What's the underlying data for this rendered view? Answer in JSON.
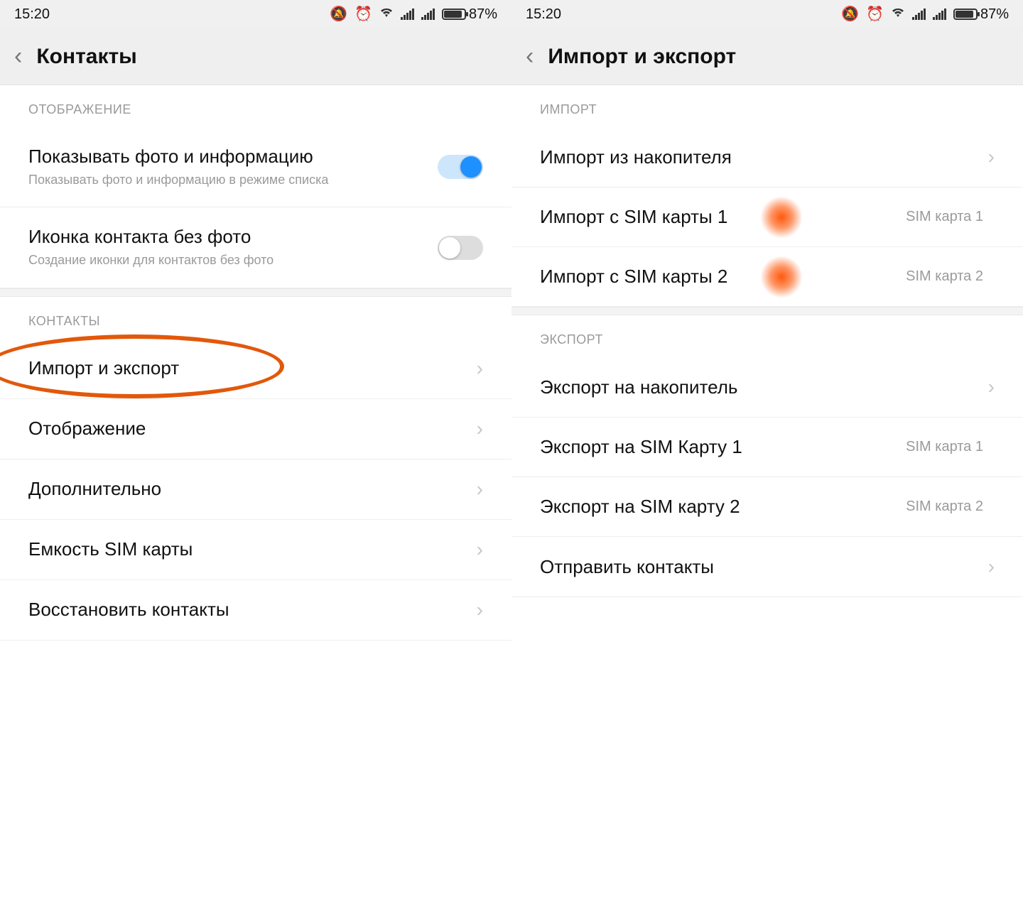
{
  "status": {
    "time": "15:20",
    "battery_pct": "87%"
  },
  "left": {
    "title": "Контакты",
    "section_display": "ОТОБРАЖЕНИЕ",
    "row_photo_title": "Показывать фото и информацию",
    "row_photo_sub": "Показывать фото и информацию в режиме списка",
    "row_icon_title": "Иконка контакта без фото",
    "row_icon_sub": "Создание иконки для контактов без фото",
    "section_contacts": "КОНТАКТЫ",
    "row_import_export": "Импорт и экспорт",
    "row_display": "Отображение",
    "row_more": "Дополнительно",
    "row_sim_capacity": "Емкость SIM карты",
    "row_restore": "Восстановить контакты"
  },
  "right": {
    "title": "Импорт и экспорт",
    "section_import": "ИМПОРТ",
    "row_import_storage": "Импорт из накопителя",
    "row_import_sim1": "Импорт с SIM карты 1",
    "row_import_sim1_val": "SIM карта 1",
    "row_import_sim2": "Импорт с SIM карты 2",
    "row_import_sim2_val": "SIM карта 2",
    "section_export": "ЭКСПОРТ",
    "row_export_storage": "Экспорт на накопитель",
    "row_export_sim1": "Экспорт на SIM Карту 1",
    "row_export_sim1_val": "SIM карта 1",
    "row_export_sim2": "Экспорт на SIM карту 2",
    "row_export_sim2_val": "SIM карта 2",
    "row_send": "Отправить контакты"
  }
}
